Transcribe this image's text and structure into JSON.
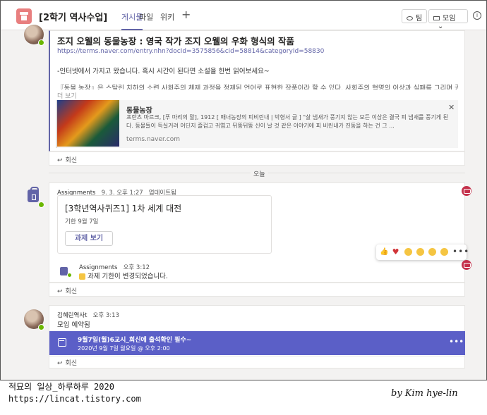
{
  "header": {
    "team_name": "[2학기 역사수업]",
    "tabs": [
      {
        "label": "게시물",
        "active": true
      },
      {
        "label": "파일",
        "active": false
      },
      {
        "label": "위키",
        "active": false
      }
    ],
    "add_tab": "+",
    "team_button": "팀",
    "meet_button": "모임",
    "meet_dropdown": "⌄",
    "info": "i"
  },
  "post1": {
    "title": "조지 오웰의 동물농장 : 영국 작가 조지 오웰의 우화 형식의 작품",
    "link": "https://terms.naver.com/entry.nhn?docId=3575856&cid=58814&categoryId=58830",
    "line1": "-인터넷에서 가지고 왔습니다. 혹시 시간이 된다면 소설을 한번 읽어보세요~",
    "line2": "『동물 농장』은 스탈린 치하의 소련 사회주의 체제 과정을 정제된 언어로 표현한 작품이라 할 수 있다. 사회주의 혁명의 이상과 실패를 그리며 권력의 속성을 우화적으로 풍자한 작품이다.",
    "see_more": "더 보기",
    "preview": {
      "title": "동물농장",
      "desc": "프란츠 마르크, [푸 마리의 말], 1912 [ 매너농장의 피비린내 | 박형서 글 ] \"살 냄새가 풍기지 않는 모든 이상은 결국 피 냄새를 풍기게 된다. 동물들이 득실거려 어딘지 즐겁고 귀엽고 뒤뚱뒤뚱 신이 날 것 같은 이야기에 피 비린내가 진동을 하는 건 그 ...",
      "site": "terms.naver.com",
      "close": "✕"
    },
    "reply": "회신"
  },
  "today_label": "오늘",
  "post2": {
    "author": "Assignments",
    "time": "9. 3. 오후 1:27",
    "edited": "업데이트됨",
    "assignment_title": "[3학년역사퀴즈1] 1차 세계 대전",
    "due": "기한 9월 7일",
    "view_button": "과제 보기",
    "reactions": [
      "👍",
      "♥",
      "😊",
      "😮",
      "😢",
      "🙂"
    ],
    "more": "•••",
    "sub_author": "Assignments",
    "sub_time": "오후 3:12",
    "sub_text": "과제 기한이 변경되었습니다.",
    "reply": "회신"
  },
  "post3": {
    "author": "김혜린역사t",
    "time": "오후 3:13",
    "text": "모임 예약됨",
    "meeting_title": "9월7일(월)6교시_회신에 출석확인 필수~",
    "meeting_time": "2020년 9월 7일 월요일 @ 오후 2:00",
    "more": "•••",
    "reply": "회신"
  },
  "footer": {
    "blog_title": "적묘의 일상_하루하루 2020",
    "blog_url": "https://lincat.tistory.com",
    "author_sign": "by Kim hye-lin"
  },
  "colors": {
    "accent": "#6264a7",
    "meeting": "#5b5fc7",
    "presence": "#6bb700"
  }
}
